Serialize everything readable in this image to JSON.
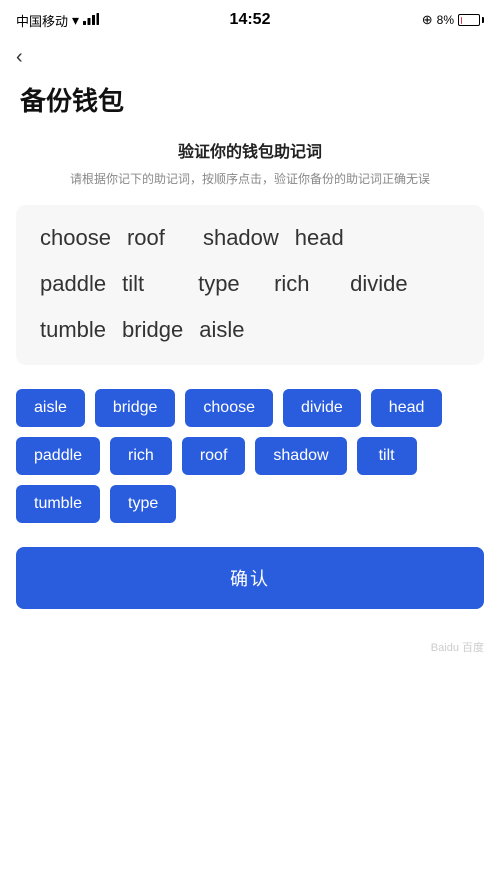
{
  "statusBar": {
    "carrier": "中国移动",
    "time": "14:52",
    "battery": "8%"
  },
  "back": {
    "arrow": "‹"
  },
  "pageTitle": "备份钱包",
  "sectionTitle": "验证你的钱包助记词",
  "sectionDesc": "请根据你记下的助记词，按顺序点击，验证你备份的助记词正确无误",
  "wordBoxRows": [
    [
      "choose",
      "roof",
      "shadow",
      "head"
    ],
    [
      "paddle",
      "tilt",
      "type",
      "rich",
      "divide"
    ],
    [
      "tumble",
      "bridge",
      "aisle"
    ]
  ],
  "wordButtons": [
    "aisle",
    "bridge",
    "choose",
    "divide",
    "head",
    "paddle",
    "rich",
    "roof",
    "shadow",
    "tilt",
    "tumble",
    "type"
  ],
  "confirmLabel": "确认"
}
